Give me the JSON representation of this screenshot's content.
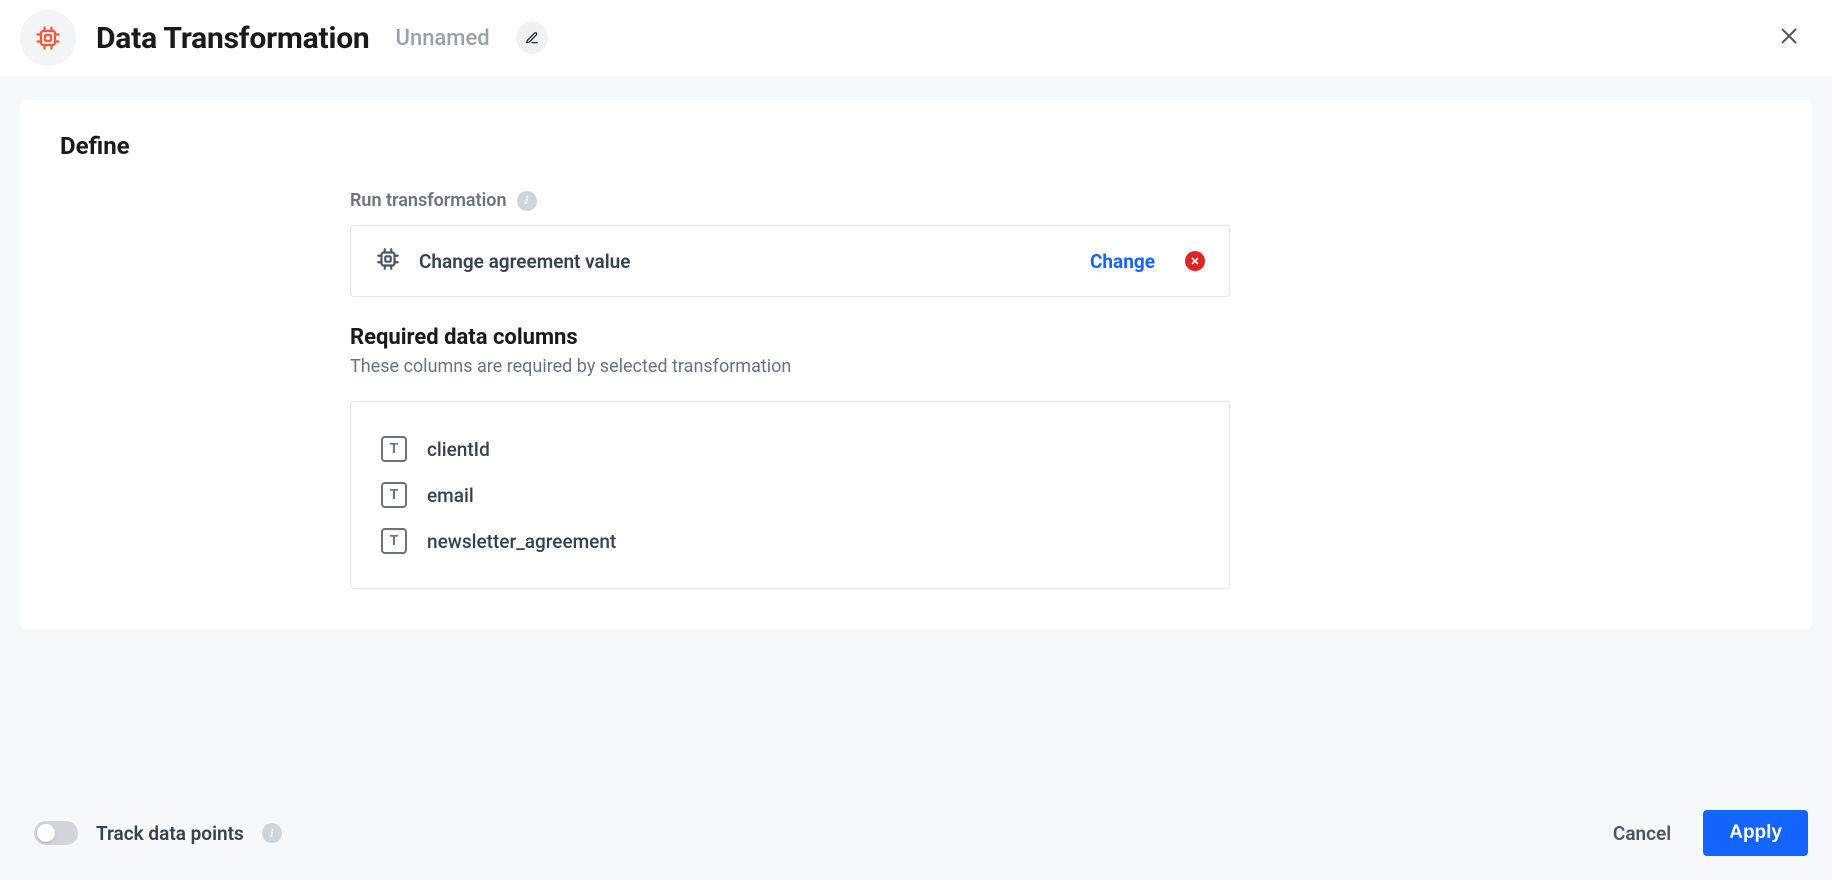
{
  "header": {
    "title": "Data Transformation",
    "subtitle": "Unnamed"
  },
  "define": {
    "heading": "Define",
    "run_label": "Run transformation",
    "transformation_name": "Change agreement value",
    "change_label": "Change",
    "required_heading": "Required data columns",
    "required_sub": "These columns are required by selected transformation",
    "columns": [
      {
        "type": "T",
        "name": "clientId"
      },
      {
        "type": "T",
        "name": "email"
      },
      {
        "type": "T",
        "name": "newsletter_agreement"
      }
    ]
  },
  "footer": {
    "track_label": "Track data points",
    "cancel": "Cancel",
    "apply": "Apply"
  }
}
